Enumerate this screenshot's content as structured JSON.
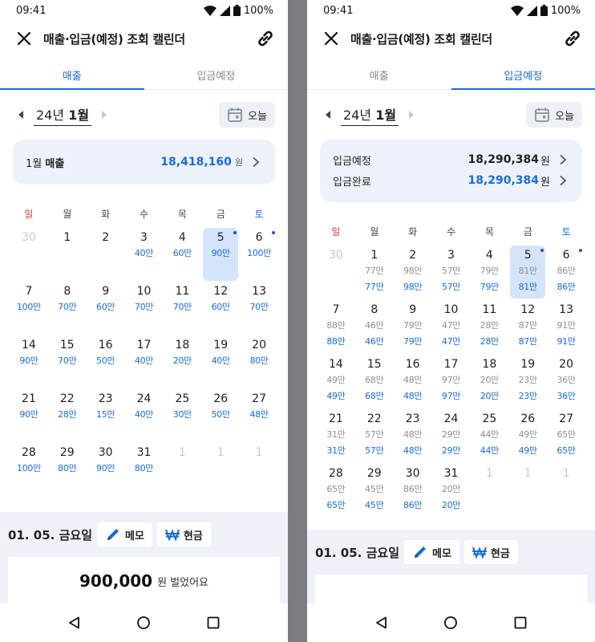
{
  "colors": {
    "accent": "#1a6bdc",
    "sunday": "#e33b3b",
    "selected_bg": "#d3e4fb",
    "summary_bg": "#edf2fa"
  },
  "status": {
    "time": "09:41",
    "battery": "100%"
  },
  "app": {
    "title": "매출·입금(예정) 조회 캘린더"
  },
  "tabs": [
    "매출",
    "입금예정"
  ],
  "month_label": {
    "year": "24년",
    "month": "1월"
  },
  "today_label": "오늘",
  "weekdays": [
    "일",
    "월",
    "화",
    "수",
    "목",
    "금",
    "토"
  ],
  "detail": {
    "date": "01. 05. 금요일",
    "memo_label": "메모",
    "cash_label": "현금"
  },
  "left": {
    "summary": {
      "month": "1월",
      "label": "매출",
      "amount": "18,418,160",
      "unit": "원"
    },
    "weeks": [
      [
        {
          "d": "30",
          "muted": true
        },
        {
          "d": "1"
        },
        {
          "d": "2"
        },
        {
          "d": "3",
          "v": "40만"
        },
        {
          "d": "4",
          "v": "60만"
        },
        {
          "d": "5",
          "v": "90만",
          "sel": true,
          "dot": true
        },
        {
          "d": "6",
          "v": "100만",
          "dot": true
        }
      ],
      [
        {
          "d": "7",
          "v": "100만"
        },
        {
          "d": "8",
          "v": "70만"
        },
        {
          "d": "9",
          "v": "60만"
        },
        {
          "d": "10",
          "v": "70만"
        },
        {
          "d": "11",
          "v": "70만"
        },
        {
          "d": "12",
          "v": "60만"
        },
        {
          "d": "13",
          "v": "70만"
        }
      ],
      [
        {
          "d": "14",
          "v": "90만"
        },
        {
          "d": "15",
          "v": "70만"
        },
        {
          "d": "16",
          "v": "50만"
        },
        {
          "d": "17",
          "v": "40만"
        },
        {
          "d": "18",
          "v": "20만"
        },
        {
          "d": "19",
          "v": "40만"
        },
        {
          "d": "20",
          "v": "80만"
        }
      ],
      [
        {
          "d": "21",
          "v": "90만"
        },
        {
          "d": "22",
          "v": "28만"
        },
        {
          "d": "23",
          "v": "15만"
        },
        {
          "d": "24",
          "v": "40만"
        },
        {
          "d": "25",
          "v": "30만"
        },
        {
          "d": "26",
          "v": "50만"
        },
        {
          "d": "27",
          "v": "48만"
        }
      ],
      [
        {
          "d": "28",
          "v": "100만"
        },
        {
          "d": "29",
          "v": "80만"
        },
        {
          "d": "30",
          "v": "90만"
        },
        {
          "d": "31",
          "v": "80만"
        },
        {
          "d": "1",
          "muted": true
        },
        {
          "d": "1",
          "muted": true
        },
        {
          "d": "1",
          "muted": true
        }
      ]
    ],
    "detail_amount": "900,000",
    "detail_suffix": "원 벌었어요"
  },
  "right": {
    "summary": [
      {
        "label": "입금예정",
        "amount": "18,290,384",
        "unit": "원"
      },
      {
        "label": "입금완료",
        "amount": "18,290,384",
        "unit": "원"
      }
    ],
    "weeks": [
      [
        {
          "d": "30",
          "muted": true
        },
        {
          "d": "1",
          "g": "77만",
          "v": "77만"
        },
        {
          "d": "2",
          "g": "98만",
          "v": "98만"
        },
        {
          "d": "3",
          "g": "57만",
          "v": "57만"
        },
        {
          "d": "4",
          "g": "79만",
          "v": "79만"
        },
        {
          "d": "5",
          "g": "81만",
          "v": "81만",
          "sel": true,
          "dot": true
        },
        {
          "d": "6",
          "g": "86만",
          "v": "86만",
          "dot": true
        }
      ],
      [
        {
          "d": "7",
          "g": "88만",
          "v": "88만"
        },
        {
          "d": "8",
          "g": "46만",
          "v": "46만"
        },
        {
          "d": "9",
          "g": "79만",
          "v": "79만"
        },
        {
          "d": "10",
          "g": "47만",
          "v": "47만"
        },
        {
          "d": "11",
          "g": "28만",
          "v": "28만"
        },
        {
          "d": "12",
          "g": "87만",
          "v": "87만"
        },
        {
          "d": "13",
          "g": "91만",
          "v": "91만"
        }
      ],
      [
        {
          "d": "14",
          "g": "49만",
          "v": "49만"
        },
        {
          "d": "15",
          "g": "68만",
          "v": "68만"
        },
        {
          "d": "16",
          "g": "48만",
          "v": "48만"
        },
        {
          "d": "17",
          "g": "97만",
          "v": "97만"
        },
        {
          "d": "18",
          "g": "20만",
          "v": "20만"
        },
        {
          "d": "19",
          "g": "23만",
          "v": "23만"
        },
        {
          "d": "20",
          "g": "36만",
          "v": "36만"
        }
      ],
      [
        {
          "d": "21",
          "g": "31만",
          "v": "31만"
        },
        {
          "d": "22",
          "g": "57만",
          "v": "57만"
        },
        {
          "d": "23",
          "g": "48만",
          "v": "48만"
        },
        {
          "d": "24",
          "g": "29만",
          "v": "29만"
        },
        {
          "d": "25",
          "g": "44만",
          "v": "44만"
        },
        {
          "d": "26",
          "g": "49만",
          "v": "49만"
        },
        {
          "d": "27",
          "g": "65만",
          "v": "65만"
        }
      ],
      [
        {
          "d": "28",
          "g": "65만",
          "v": "65만"
        },
        {
          "d": "29",
          "g": "45만",
          "v": "45만"
        },
        {
          "d": "30",
          "g": "86만",
          "v": "86만"
        },
        {
          "d": "31",
          "g": "20만",
          "v": "20만"
        },
        {
          "d": "1",
          "muted": true
        },
        {
          "d": "1",
          "muted": true
        },
        {
          "d": "1",
          "muted": true
        }
      ]
    ]
  }
}
